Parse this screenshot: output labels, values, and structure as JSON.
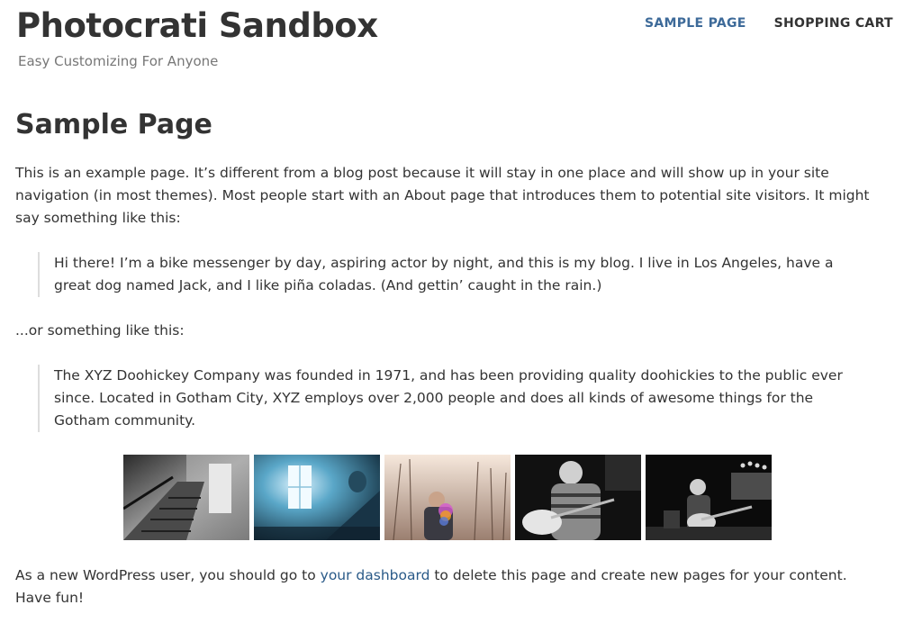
{
  "site": {
    "title": "Photocrati Sandbox",
    "description": "Easy Customizing For Anyone"
  },
  "nav": {
    "items": [
      {
        "label": "SAMPLE PAGE",
        "current": true
      },
      {
        "label": "SHOPPING CART",
        "current": false
      }
    ]
  },
  "page": {
    "title": "Sample Page",
    "intro": "This is an example page. It’s different from a blog post because it will stay in one place and will show up in your site navigation (in most themes). Most people start with an About page that introduces them to potential site visitors. It might say something like this:",
    "quote1": "Hi there! I’m a bike messenger by day, aspiring actor by night, and this is my blog. I live in Los Angeles, have a great dog named Jack, and I like piña coladas. (And gettin’ caught in the rain.)",
    "middle": "...or something like this:",
    "quote2": "The XYZ Doohickey Company was founded in 1971, and has been providing quality doohickies to the public ever since. Located in Gotham City, XYZ employs over 2,000 people and does all kinds of awesome things for the Gotham community.",
    "outro_before": "As a new WordPress user, you should go to ",
    "outro_link": "your dashboard",
    "outro_after": " to delete this page and create new pages for your content. Have fun!"
  },
  "gallery": {
    "images": [
      {
        "name": "staircase-photo"
      },
      {
        "name": "blue-window-room-photo"
      },
      {
        "name": "man-with-trees-photo"
      },
      {
        "name": "guitarist-bw-photo"
      },
      {
        "name": "band-on-stage-photo"
      }
    ]
  }
}
